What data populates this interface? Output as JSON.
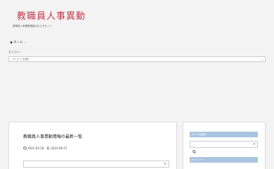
{
  "header": {
    "site_title": "教職員人事異動",
    "tagline": "教職員人事異動情報のまとめサイト"
  },
  "nav": {
    "home_label": "ホーム"
  },
  "filter": {
    "label": "カテゴリー",
    "selected": "カテゴリーを選択"
  },
  "article": {
    "title": "教職員人事異動情報の最新一覧",
    "published": "2021-03-18",
    "updated": "2023-06-27",
    "search_placeholder": ""
  },
  "sidebar": {
    "widget1_title": "サイト内検索",
    "widget2_title": "カテゴリー",
    "search_placeholder": ""
  },
  "colors": {
    "brand": "#c4384a",
    "widget_header": "#a9c4df"
  }
}
